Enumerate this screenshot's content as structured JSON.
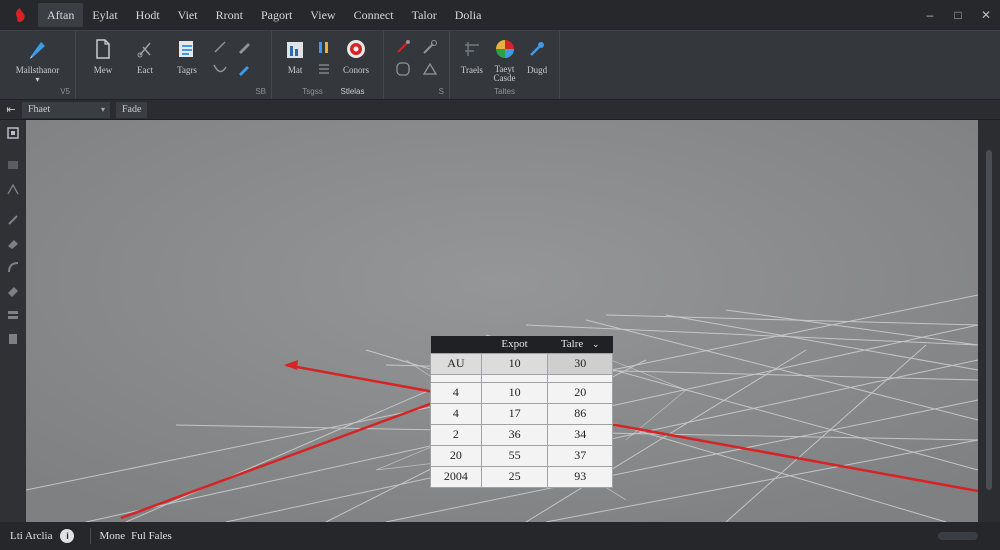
{
  "menu": {
    "items": [
      "Aftan",
      "Eylat",
      "Hodt",
      "Viet",
      "Rront",
      "Pagort",
      "View",
      "Connect",
      "Talor",
      "Dolia"
    ]
  },
  "ribbon": {
    "groups": [
      {
        "buttons": [
          {
            "label": "Mallsthanor",
            "icon": "pen-nib-icon"
          }
        ],
        "label": "",
        "launcher": "V5"
      },
      {
        "buttons": [
          {
            "label": "Mew",
            "icon": "new-document-icon"
          },
          {
            "label": "Eact",
            "icon": "scissors-icon"
          },
          {
            "label": "Tagrs",
            "icon": "paste-icon"
          }
        ],
        "label": "",
        "launcher": "SB"
      },
      {
        "buttons": [
          {
            "label": "Mat",
            "icon": "column-chart-icon"
          },
          {
            "label": "Conors",
            "icon": "color-wheel-icon"
          }
        ],
        "label": "Tsgss",
        "launcher": "S",
        "extra": "Stlelas"
      },
      {
        "buttons": [],
        "label": "",
        "launcher": "S"
      },
      {
        "buttons": [
          {
            "label": "Traels",
            "icon": "table-tool-icon"
          },
          {
            "label": "Taeyt\nCasde",
            "icon": "globe-icon"
          },
          {
            "label": "Dugd",
            "icon": "pin-tool-icon"
          }
        ],
        "label": "Taltes",
        "launcher": ""
      }
    ]
  },
  "subbar": {
    "dropdown": "Fhaet",
    "tab": "Fade"
  },
  "table": {
    "headers": [
      "",
      "Expot",
      "Talre"
    ],
    "rows": [
      [
        "AU",
        "10",
        "30"
      ],
      [
        "",
        "",
        ""
      ],
      [
        "4",
        "10",
        "20"
      ],
      [
        "4",
        "17",
        "86"
      ],
      [
        "2",
        "36",
        "34"
      ],
      [
        "20",
        "55",
        "37"
      ],
      [
        "2004",
        "25",
        "93"
      ]
    ]
  },
  "status": {
    "app": "Lti Arclia",
    "mode": "Mone",
    "files": "Ful Fales"
  },
  "colors": {
    "accent_red": "#d62424",
    "viewport_bg": "#8a8b8d",
    "grid": "#d7d8da"
  }
}
